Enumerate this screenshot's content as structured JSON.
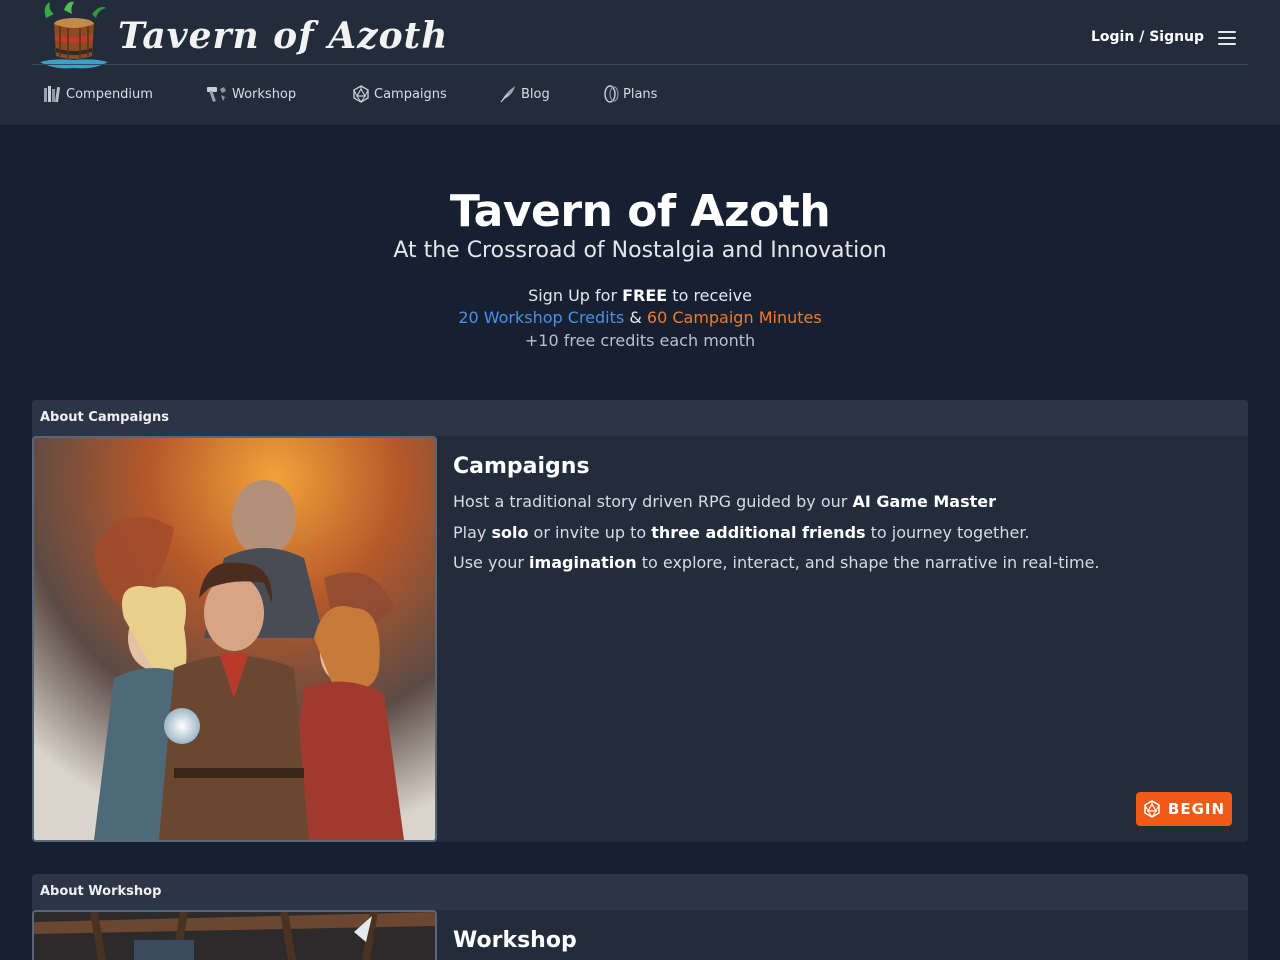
{
  "header": {
    "brand": "Tavern of Azoth",
    "login_label": "Login / Signup"
  },
  "nav": {
    "compendium": "Compendium",
    "workshop": "Workshop",
    "campaigns": "Campaigns",
    "blog": "Blog",
    "plans": "Plans"
  },
  "hero": {
    "title": "Tavern of Azoth",
    "subtitle": "At the Crossroad of Nostalgia and Innovation",
    "signup_pre": "Sign Up for ",
    "signup_free": "FREE",
    "signup_post": " to receive",
    "workshop_credits": "20 Workshop Credits",
    "ampersand": " & ",
    "campaign_minutes": "60 Campaign Minutes",
    "monthly": "+10 free credits each month"
  },
  "campaigns_card": {
    "header": "About Campaigns",
    "title": "Campaigns",
    "line1_pre": "Host a traditional story driven RPG guided by our ",
    "line1_bold": "AI Game Master",
    "line2_pre": "Play ",
    "line2_bold1": "solo",
    "line2_mid": " or invite up to ",
    "line2_bold2": "three additional friends",
    "line2_post": " to journey together.",
    "line3_pre": "Use your ",
    "line3_bold": "imagination",
    "line3_post": " to explore, interact, and shape the narrative in real-time.",
    "begin_label": "BEGIN"
  },
  "workshop_card": {
    "header": "About Workshop",
    "title": "Workshop"
  },
  "colors": {
    "background": "#172030",
    "header": "#222c3b",
    "accent_blue": "#4c8fe6",
    "accent_orange": "#f07a2a",
    "button": "#f05a16"
  },
  "icons": {
    "logo": "barrel-logo",
    "compendium": "books-icon",
    "workshop": "hammer-icon",
    "campaigns": "d20-icon",
    "blog": "quill-icon",
    "plans": "coins-icon",
    "menu": "hamburger-menu-icon",
    "begin": "d20-icon"
  }
}
